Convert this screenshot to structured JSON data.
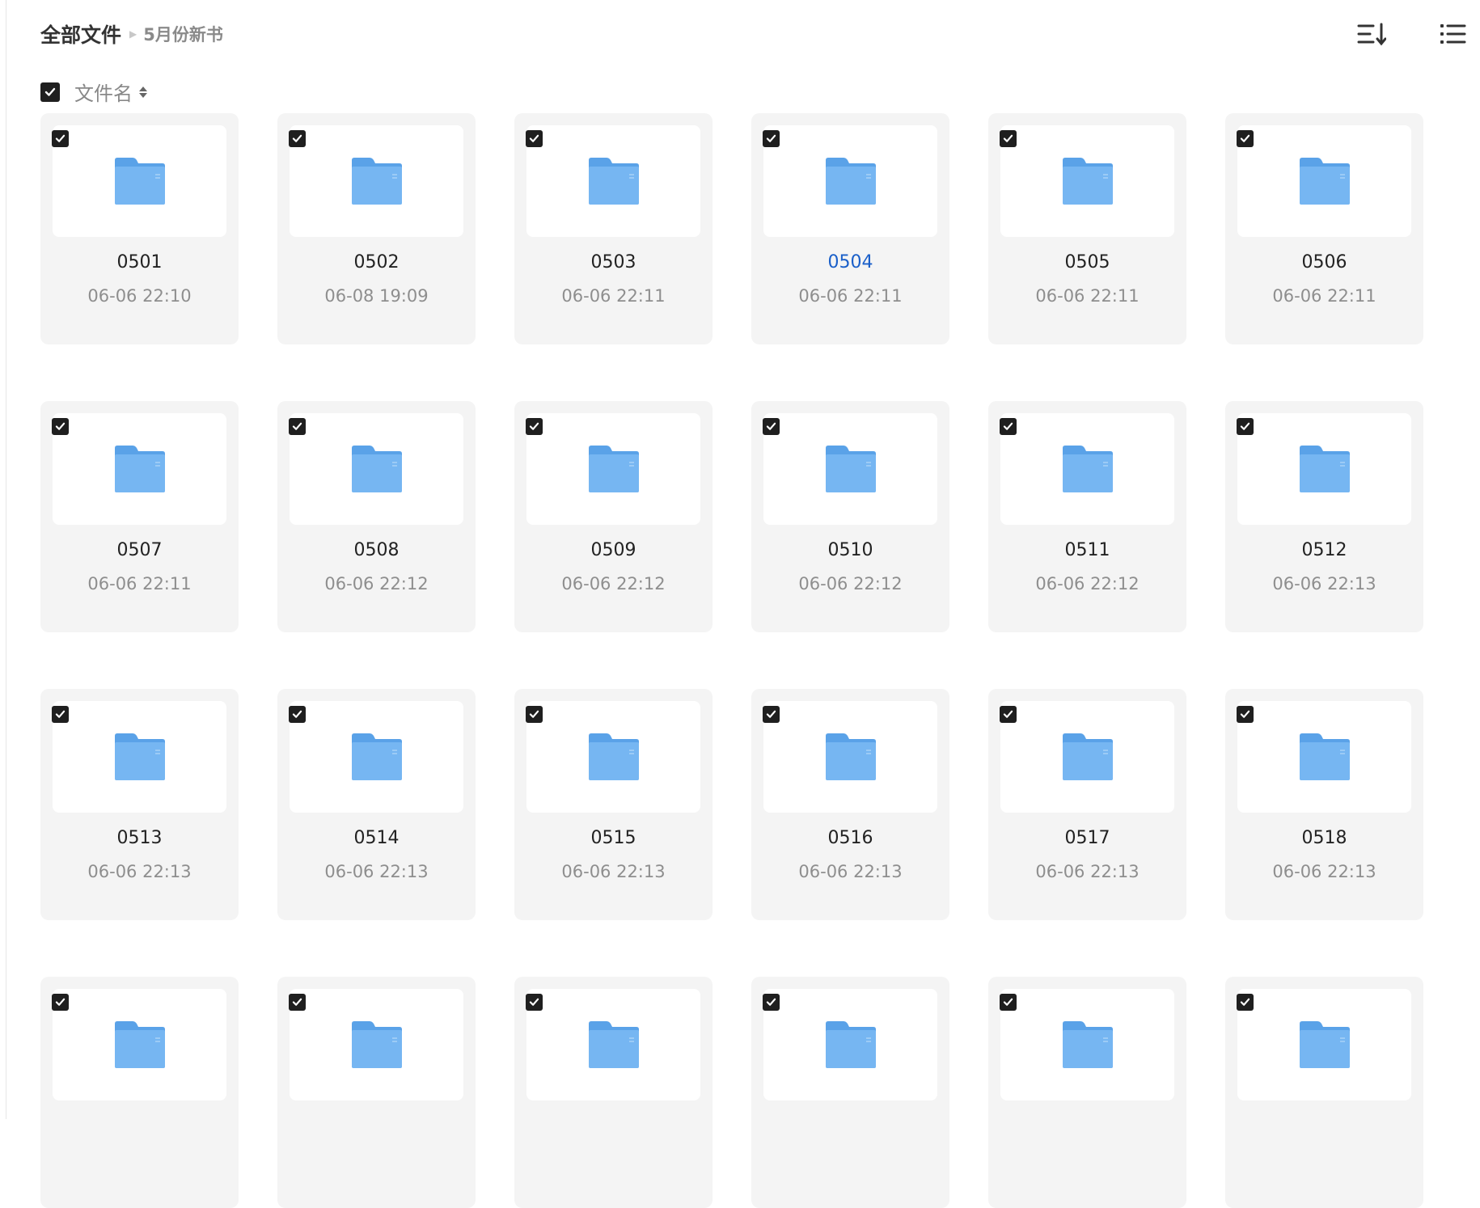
{
  "breadcrumb": {
    "root": "全部文件",
    "current": "5月份新书"
  },
  "toolbar": {
    "sort_icon": "sort-order-icon",
    "view_icon": "list-view-icon"
  },
  "sort_bar": {
    "label": "文件名",
    "select_all_checked": true
  },
  "colors": {
    "folder": "#6aaff0",
    "checkbox": "#1f1f1f",
    "active_name": "#1a5fc9",
    "card_bg": "#f4f4f4"
  },
  "folders": [
    {
      "name": "0501",
      "date": "06-06 22:10"
    },
    {
      "name": "0502",
      "date": "06-08 19:09"
    },
    {
      "name": "0503",
      "date": "06-06 22:11"
    },
    {
      "name": "0504",
      "date": "06-06 22:11",
      "active": true
    },
    {
      "name": "0505",
      "date": "06-06 22:11"
    },
    {
      "name": "0506",
      "date": "06-06 22:11"
    },
    {
      "name": "0507",
      "date": "06-06 22:11"
    },
    {
      "name": "0508",
      "date": "06-06 22:12"
    },
    {
      "name": "0509",
      "date": "06-06 22:12"
    },
    {
      "name": "0510",
      "date": "06-06 22:12"
    },
    {
      "name": "0511",
      "date": "06-06 22:12"
    },
    {
      "name": "0512",
      "date": "06-06 22:13"
    },
    {
      "name": "0513",
      "date": "06-06 22:13"
    },
    {
      "name": "0514",
      "date": "06-06 22:13"
    },
    {
      "name": "0515",
      "date": "06-06 22:13"
    },
    {
      "name": "0516",
      "date": "06-06 22:13"
    },
    {
      "name": "0517",
      "date": "06-06 22:13"
    },
    {
      "name": "0518",
      "date": "06-06 22:13"
    },
    {
      "name": "",
      "date": ""
    },
    {
      "name": "",
      "date": ""
    },
    {
      "name": "",
      "date": ""
    },
    {
      "name": "",
      "date": ""
    },
    {
      "name": "",
      "date": ""
    },
    {
      "name": "",
      "date": ""
    }
  ]
}
